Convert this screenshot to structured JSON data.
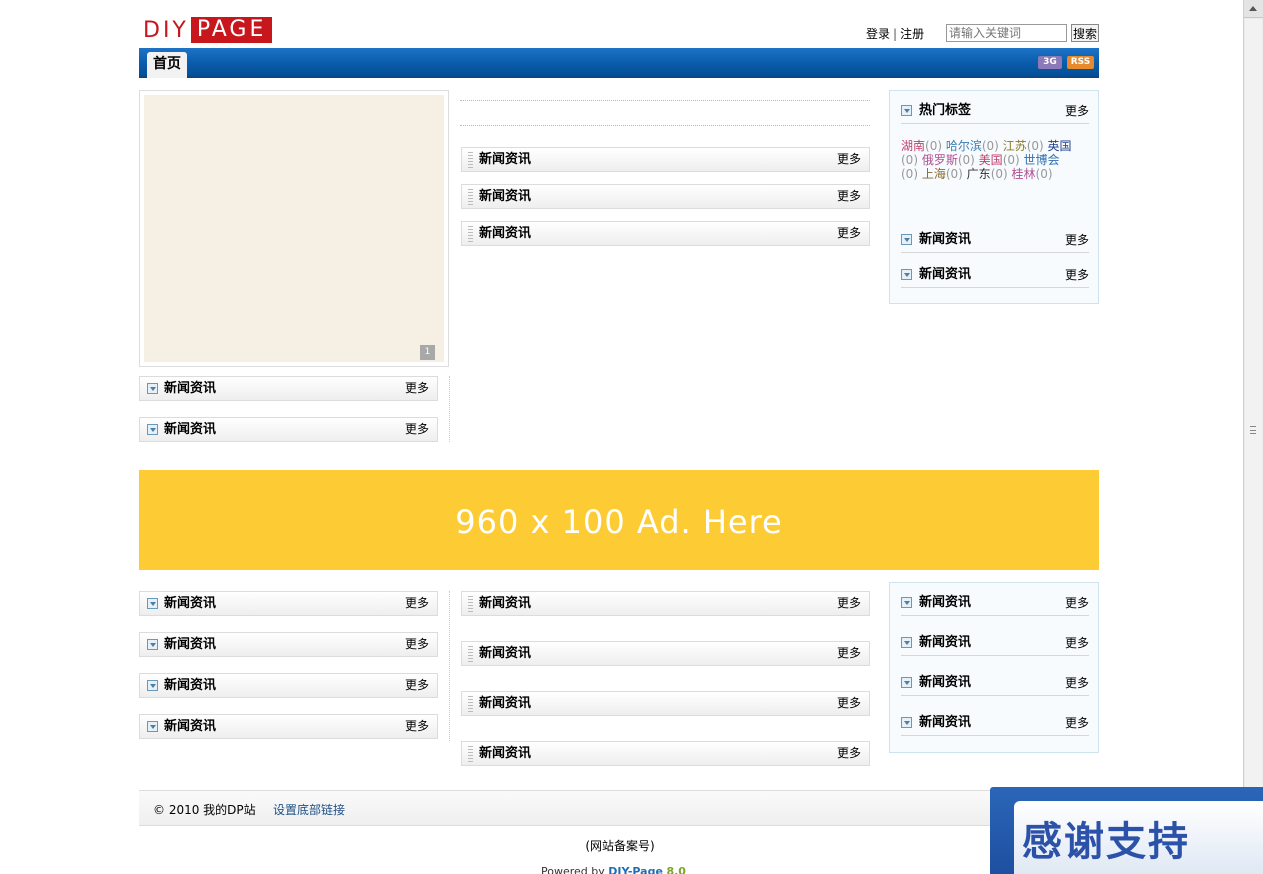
{
  "header": {
    "logo_left": "DIY",
    "logo_right": "PAGE",
    "login": "登录",
    "separator": "|",
    "register": "注册",
    "search_placeholder": "请输入关键词",
    "search_button": "搜索"
  },
  "nav": {
    "home_tab": "首页",
    "badge_3g": "3G",
    "badge_rss": "RSS"
  },
  "slideshow": {
    "pager": "1"
  },
  "hot_tags": {
    "title": "热门标签",
    "more": "更多",
    "items": [
      {
        "name": "湖南",
        "count": "(0)",
        "color": "#c0406a"
      },
      {
        "name": "哈尔滨",
        "count": "(0)",
        "color": "#3c7fb0"
      },
      {
        "name": "江苏",
        "count": "(0)",
        "color": "#8a7a2a"
      },
      {
        "name": "英国",
        "count": "(0)",
        "color": "#1f3f8f"
      },
      {
        "name": "俄罗斯",
        "count": "(0)",
        "color": "#b05090"
      },
      {
        "name": "美国",
        "count": "(0)",
        "color": "#c0406a"
      },
      {
        "name": "世博会",
        "count": "(0)",
        "color": "#2f6fb0"
      },
      {
        "name": "上海",
        "count": "(0)",
        "color": "#8a6a2a"
      },
      {
        "name": "广东",
        "count": "(0)",
        "color": "#333333"
      },
      {
        "name": "桂林",
        "count": "(0)",
        "color": "#b05090"
      }
    ]
  },
  "module": {
    "title": "新闻资讯",
    "more": "更多"
  },
  "ad": {
    "text": "960 x 100 Ad. Here",
    "color": "#fdcc34"
  },
  "footer": {
    "copyright": "© 2010 我的DP站",
    "footer_link": "设置底部链接",
    "icp": "(网站备案号)",
    "powered_prefix": "Powered by",
    "powered_brand": "DIY-Page",
    "powered_version": "8.0"
  },
  "thanks_banner": {
    "text": "感谢支持"
  },
  "colors": {
    "nav_blue": "#085aa8",
    "logo_red": "#c8161d"
  }
}
